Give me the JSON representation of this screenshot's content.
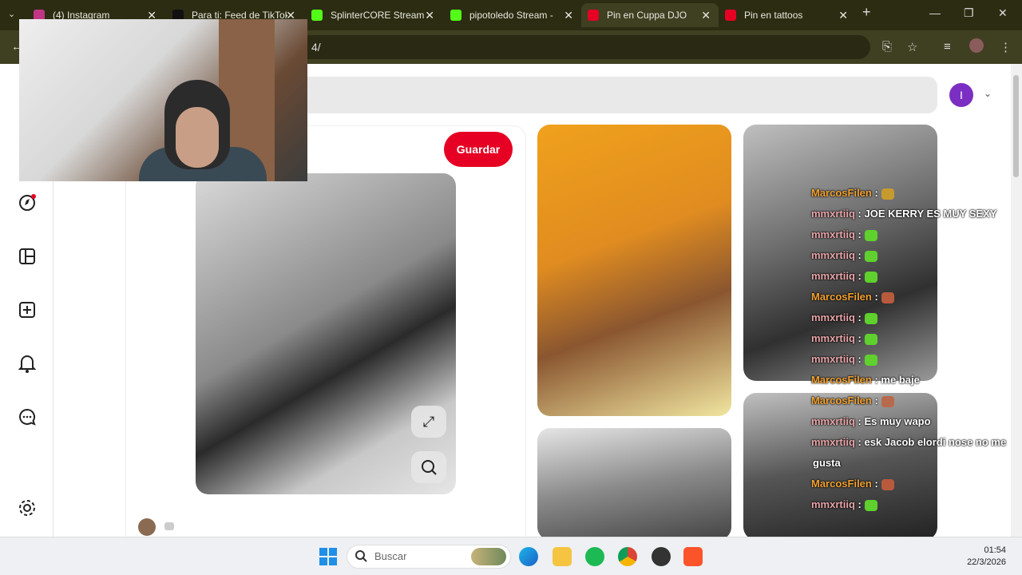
{
  "tabs": [
    {
      "label": "(4) Instagram",
      "icon": "instagram-icon",
      "color": "#c13584"
    },
    {
      "label": "Para ti: Feed de TikTok",
      "icon": "tiktok-icon",
      "color": "#111111"
    },
    {
      "label": "SplinterCORE Stream",
      "icon": "kick-icon",
      "color": "#53fc18"
    },
    {
      "label": "pipotoledo Stream - ",
      "icon": "kick-icon",
      "color": "#53fc18"
    },
    {
      "label": "Pin en Cuppa DJO",
      "icon": "pinterest-icon",
      "color": "#e60023"
    },
    {
      "label": "Pin en tattoos",
      "icon": "pinterest-icon",
      "color": "#e60023"
    }
  ],
  "address": {
    "url_fragment": "4/"
  },
  "pinterest": {
    "save_label": "Guardar",
    "avatar_letter": "I",
    "accent": "#e60023"
  },
  "chat": [
    {
      "user": "MarcosFilen",
      "sep": " :",
      "text": "",
      "emote": "#c79a2e",
      "role": "o"
    },
    {
      "user": "mmxrtiiq",
      "sep": " :",
      "text": " JOE KERRY ES MUY SEXY",
      "emote": "",
      "role": "m"
    },
    {
      "user": "mmxrtiiq",
      "sep": " :",
      "text": "",
      "emote": "#5fd02e",
      "role": "m"
    },
    {
      "user": "mmxrtiiq",
      "sep": " :",
      "text": "",
      "emote": "#5fd02e",
      "role": "m"
    },
    {
      "user": "mmxrtiiq",
      "sep": " :",
      "text": "",
      "emote": "#5fd02e",
      "role": "m"
    },
    {
      "user": "MarcosFilen",
      "sep": " :",
      "text": "",
      "emote": "#b85a3c",
      "role": "o"
    },
    {
      "user": "mmxrtiiq",
      "sep": " :",
      "text": "",
      "emote": "#5fd02e",
      "role": "m"
    },
    {
      "user": "mmxrtiiq",
      "sep": " :",
      "text": "",
      "emote": "#5fd02e",
      "role": "m"
    },
    {
      "user": "mmxrtiiq",
      "sep": " :",
      "text": "",
      "emote": "#5fd02e",
      "role": "m"
    },
    {
      "user": "MarcosFilen",
      "sep": " :",
      "text": " me baje",
      "emote": "",
      "role": "o"
    },
    {
      "user": "MarcosFilen",
      "sep": " :",
      "text": "",
      "emote": "#b86a4c",
      "role": "o"
    },
    {
      "user": "mmxrtiiq",
      "sep": " :",
      "text": " Es muy wapo",
      "emote": "",
      "role": "m"
    },
    {
      "user": "mmxrtiiq",
      "sep": " :",
      "text": " esk Jacob elordi nose no me",
      "emote": "",
      "role": "m"
    },
    {
      "user": "",
      "sep": "",
      "text": "gusta",
      "emote": "",
      "role": "m"
    },
    {
      "user": "MarcosFilen",
      "sep": " :",
      "text": "",
      "emote": "#b85a3c",
      "role": "o"
    },
    {
      "user": "mmxrtiiq",
      "sep": " :",
      "text": "",
      "emote": "#5fd02e",
      "role": "m"
    }
  ],
  "taskbar": {
    "search_placeholder": "Buscar",
    "time": "01:54",
    "date": "22/3/2026"
  }
}
